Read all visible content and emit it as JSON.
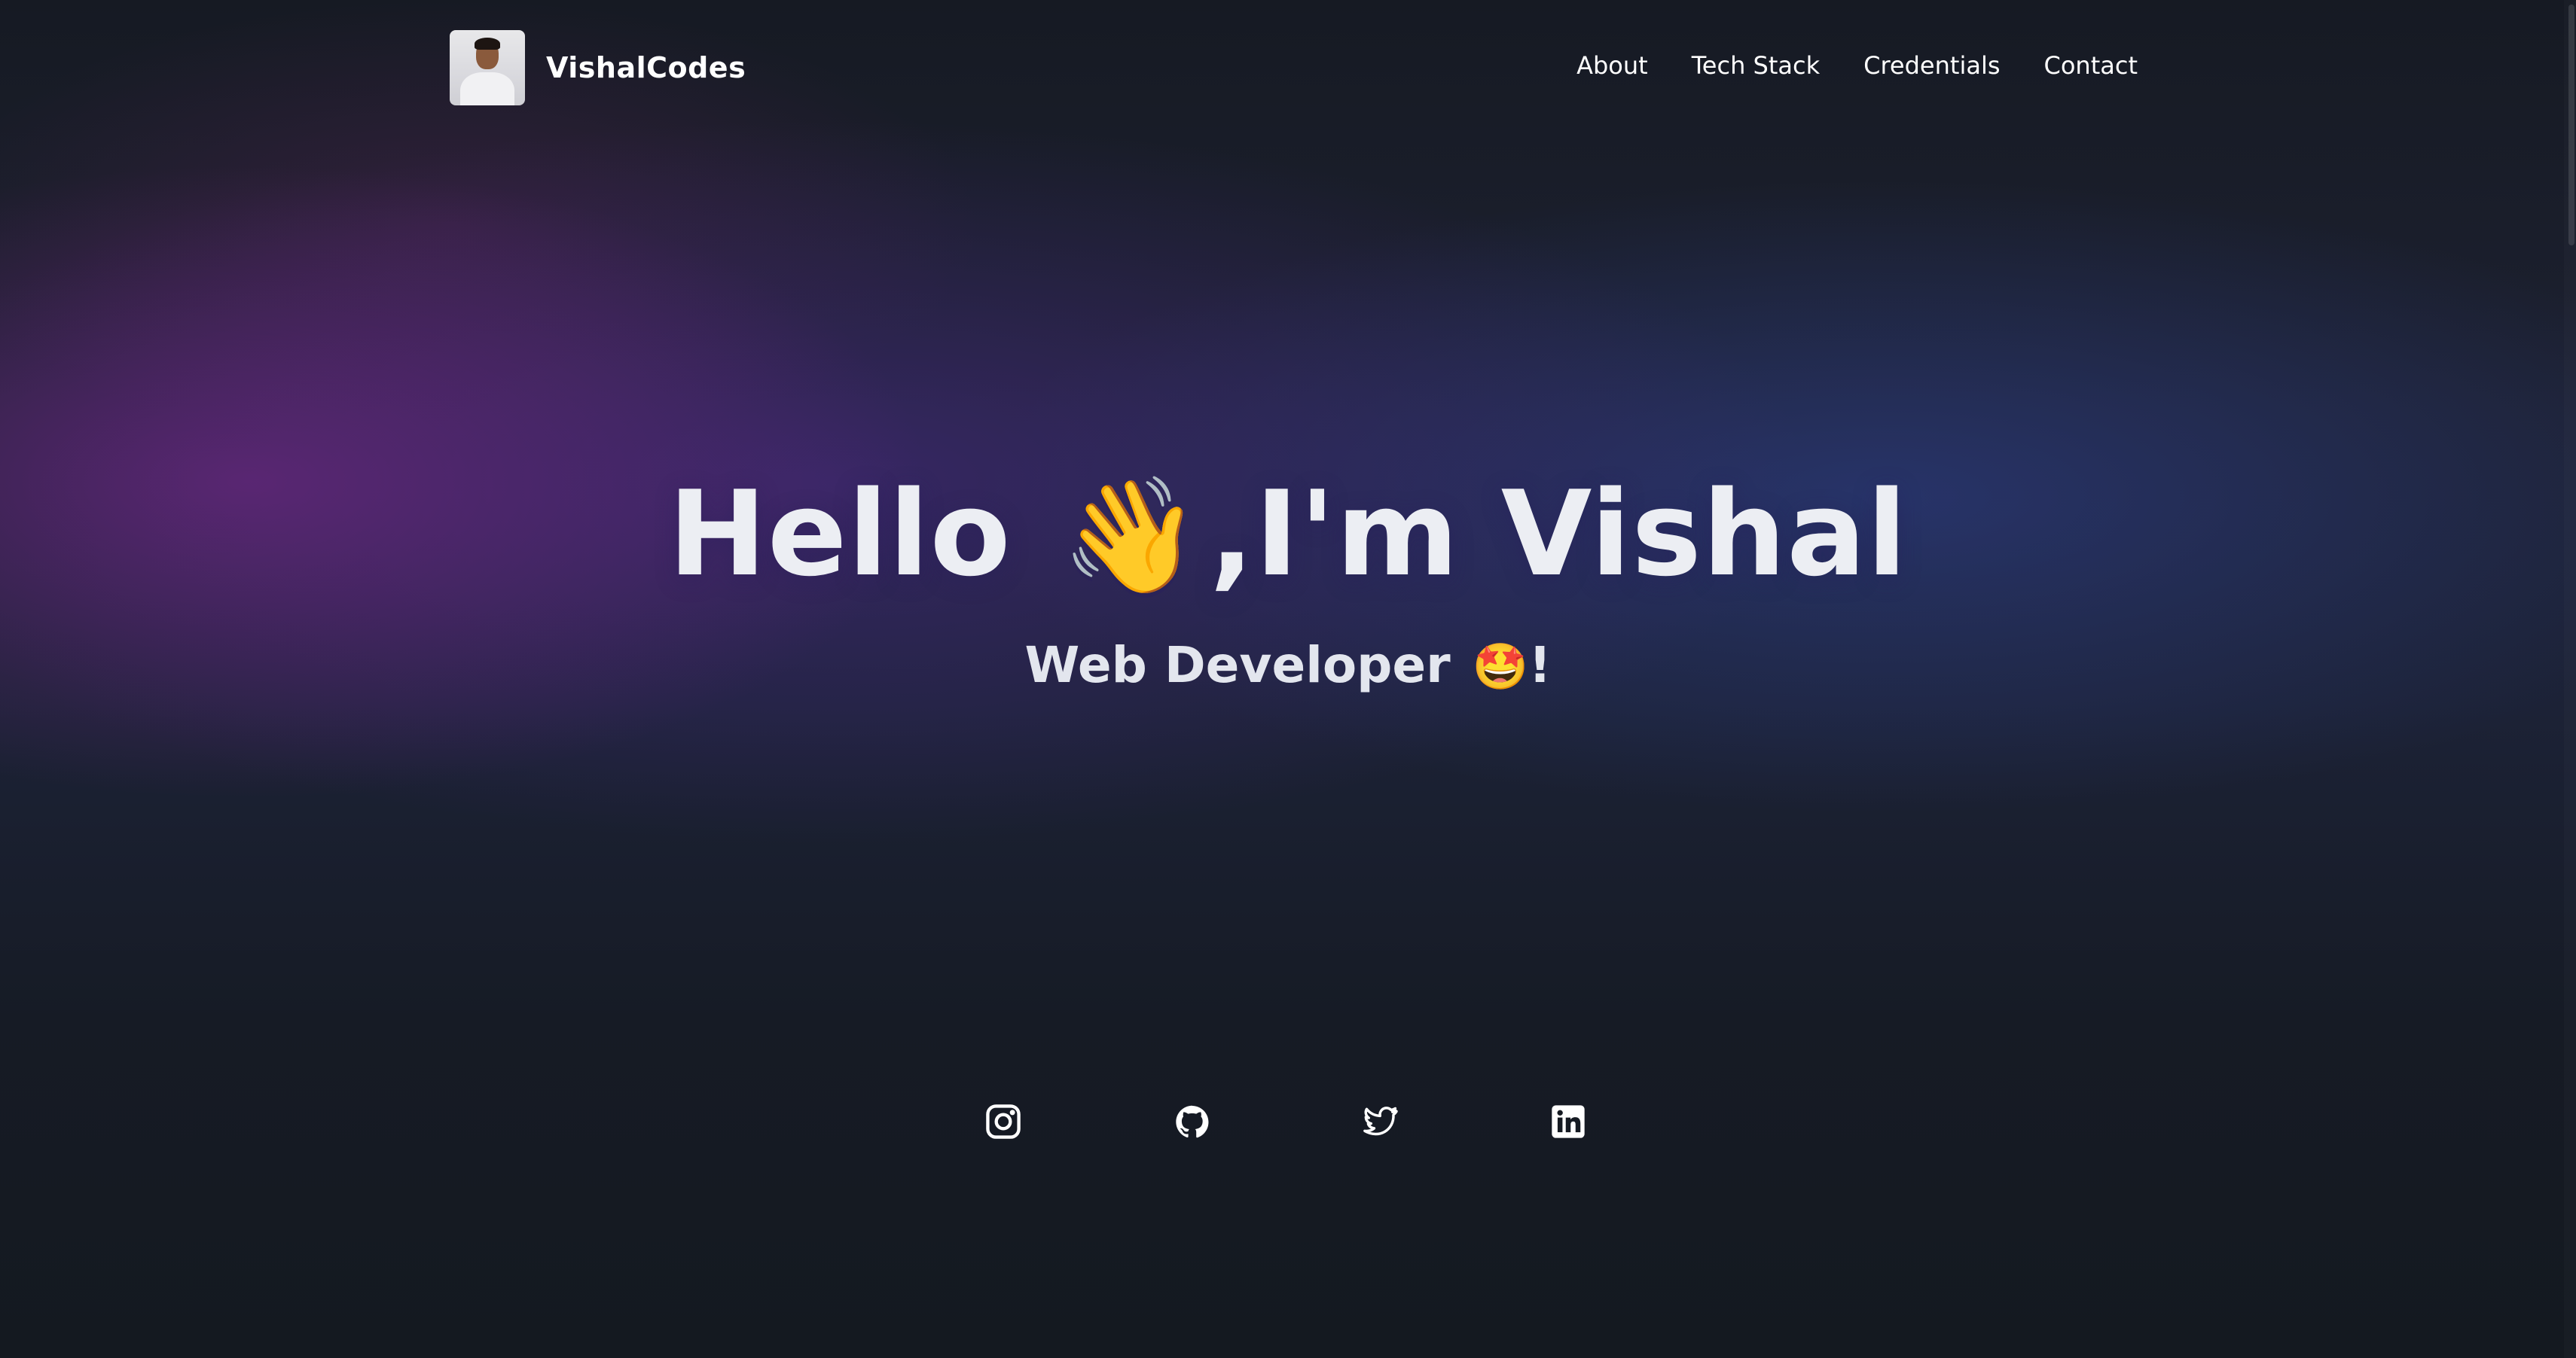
{
  "header": {
    "brand_name": "VishalCodes",
    "avatar_alt": "avatar photo",
    "nav": [
      {
        "label": "About"
      },
      {
        "label": "Tech Stack"
      },
      {
        "label": "Credentials"
      },
      {
        "label": "Contact"
      }
    ]
  },
  "hero": {
    "title_before": "Hello",
    "title_emoji": "👋",
    "title_after": ",I'm Vishal",
    "subtitle_text": "Web Developer",
    "subtitle_emoji": "🤩",
    "subtitle_end": "!"
  },
  "social": [
    {
      "icon": "instagram-icon"
    },
    {
      "icon": "github-icon"
    },
    {
      "icon": "twitter-icon"
    },
    {
      "icon": "linkedin-icon"
    }
  ],
  "colors": {
    "background": "#151a22",
    "text": "#ffffff",
    "accent_purple": "#822896",
    "accent_blue": "#3246a0"
  }
}
